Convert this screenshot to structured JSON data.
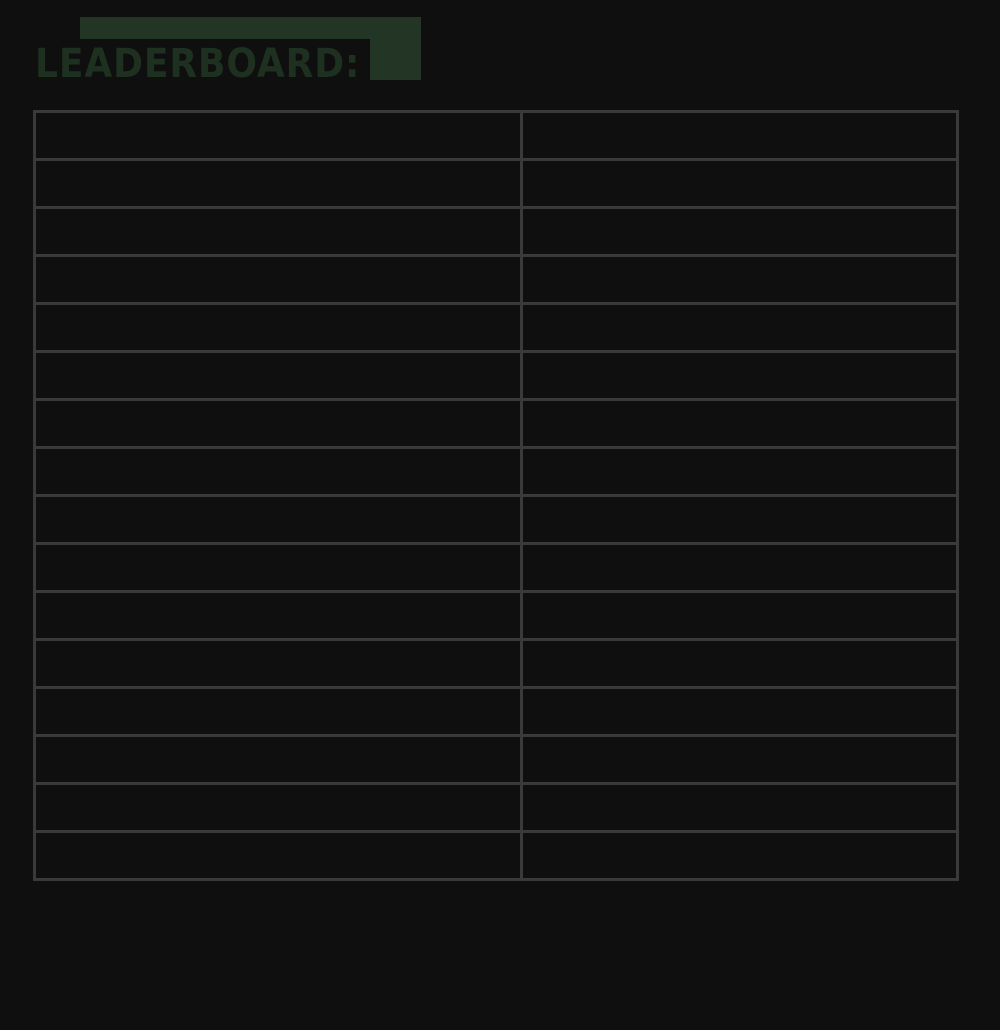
{
  "header": {
    "title": "LEADERBOARD:",
    "accent_color": "#233525"
  },
  "leaderboard": {
    "rows": [
      {
        "name": "",
        "score": ""
      },
      {
        "name": "",
        "score": ""
      },
      {
        "name": "",
        "score": ""
      },
      {
        "name": "",
        "score": ""
      },
      {
        "name": "",
        "score": ""
      },
      {
        "name": "",
        "score": ""
      },
      {
        "name": "",
        "score": ""
      },
      {
        "name": "",
        "score": ""
      },
      {
        "name": "",
        "score": ""
      },
      {
        "name": "",
        "score": ""
      },
      {
        "name": "",
        "score": ""
      },
      {
        "name": "",
        "score": ""
      },
      {
        "name": "",
        "score": ""
      },
      {
        "name": "",
        "score": ""
      },
      {
        "name": "",
        "score": ""
      },
      {
        "name": "",
        "score": ""
      }
    ]
  }
}
